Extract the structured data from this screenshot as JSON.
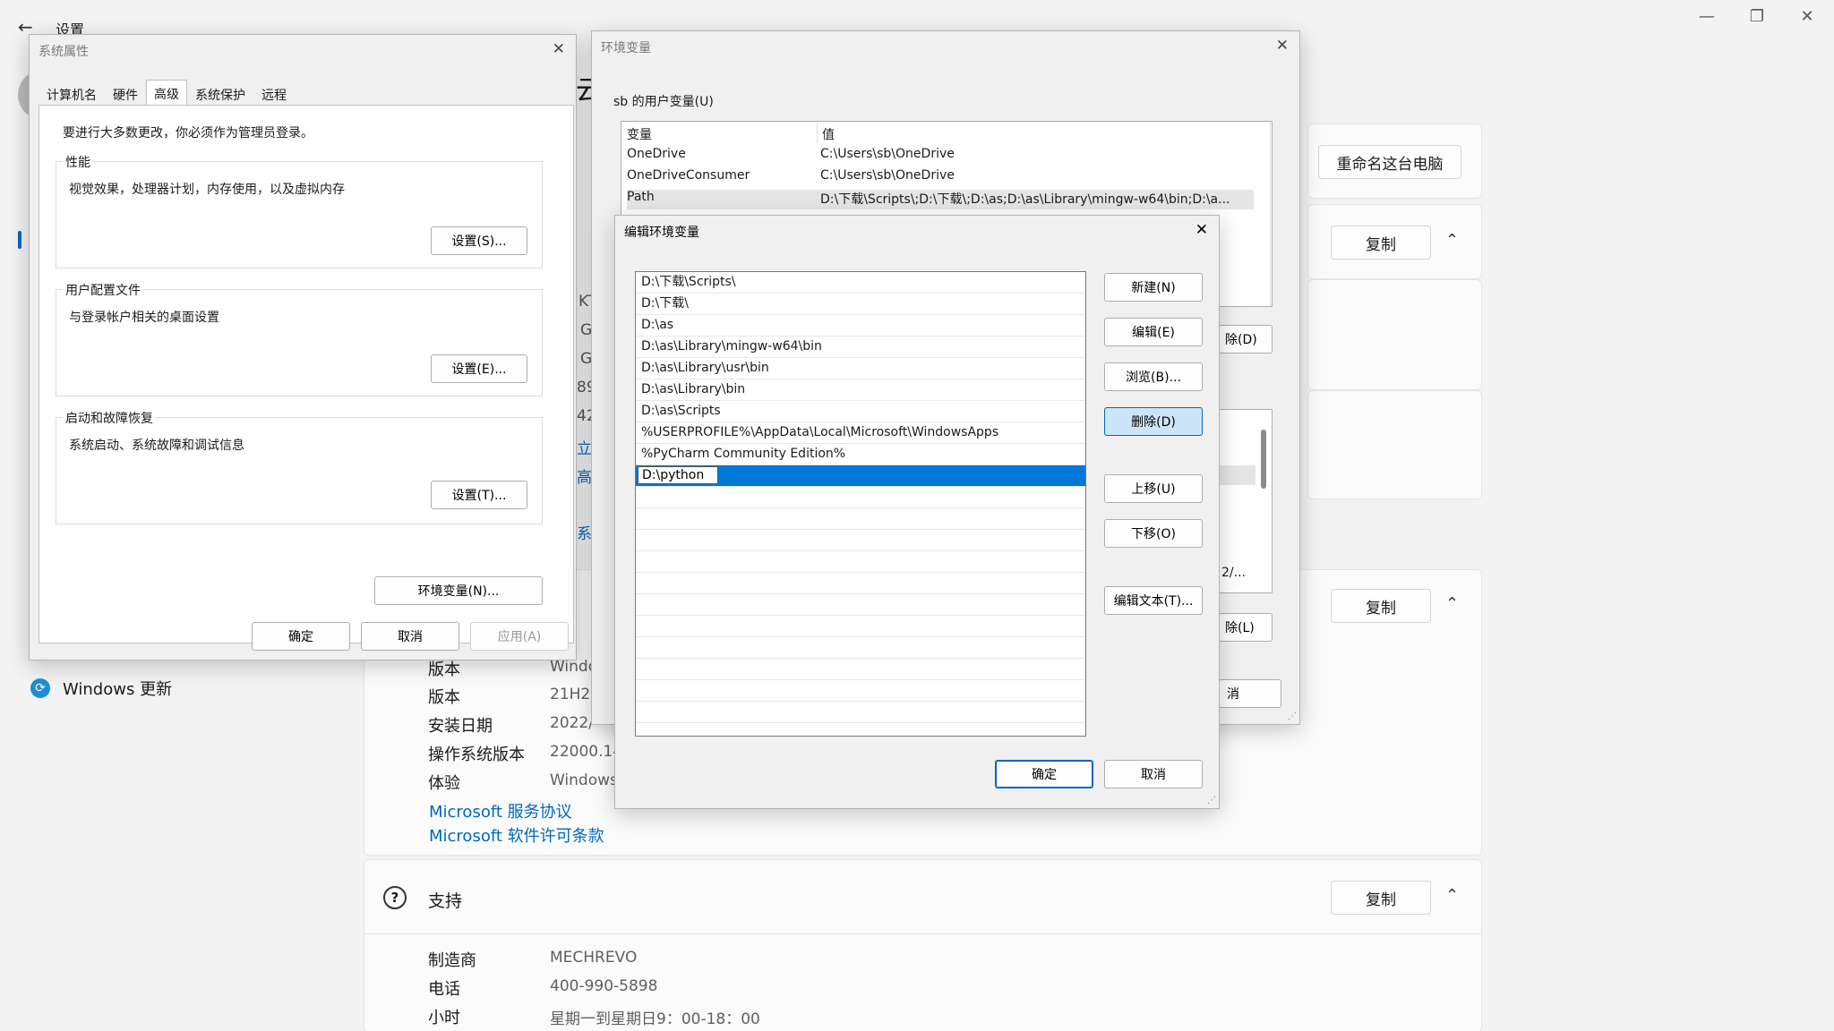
{
  "settings": {
    "title": "设置",
    "nav_windows_update": "Windows 更新",
    "rename_button": "重命名这台电脑",
    "copy_label": "复制",
    "windows_spec_rows": [
      {
        "label": "版本",
        "value": "Windo"
      },
      {
        "label": "版本",
        "value": "21H2"
      },
      {
        "label": "安装日期",
        "value": "2022/"
      },
      {
        "label": "操作系统版本",
        "value": "22000.14"
      },
      {
        "label": "体验",
        "value": "Windows"
      }
    ],
    "links": [
      "Microsoft 服务协议",
      "Microsoft 软件许可条款"
    ],
    "support": {
      "title": "支持",
      "rows": [
        {
          "label": "制造商",
          "value": "MECHREVO"
        },
        {
          "label": "电话",
          "value": "400-990-5898"
        },
        {
          "label": "小时",
          "value": "星期一到星期日9：00-18：00"
        }
      ]
    },
    "partial": {
      "heading_frag": "云",
      "k": "KT",
      "g1": "G",
      "g2": "G",
      "n89": "89",
      "n42": "42",
      "li": "立",
      "lin": "高",
      "xi": "系"
    }
  },
  "sysprops": {
    "title": "系统属性",
    "tabs": [
      "计算机名",
      "硬件",
      "高级",
      "系统保护",
      "远程"
    ],
    "admin_note": "要进行大多数更改，你必须作为管理员登录。",
    "groups": [
      {
        "label": "性能",
        "desc": "视觉效果，处理器计划，内存使用，以及虚拟内存",
        "button": "设置(S)..."
      },
      {
        "label": "用户配置文件",
        "desc": "与登录帐户相关的桌面设置",
        "button": "设置(E)..."
      },
      {
        "label": "启动和故障恢复",
        "desc": "系统启动、系统故障和调试信息",
        "button": "设置(T)..."
      }
    ],
    "env_button": "环境变量(N)...",
    "ok": "确定",
    "cancel": "取消",
    "apply": "应用(A)"
  },
  "envvars": {
    "title": "环境变量",
    "user_section": "sb 的用户变量(U)",
    "col_var": "变量",
    "col_val": "值",
    "rows": [
      {
        "name": "OneDrive",
        "value": "C:\\Users\\sb\\OneDrive"
      },
      {
        "name": "OneDriveConsumer",
        "value": "C:\\Users\\sb\\OneDrive"
      },
      {
        "name": "Path",
        "value": "D:\\下载\\Scripts\\;D:\\下载\\;D:\\as;D:\\as\\Library\\mingw-w64\\bin;D:\\a..."
      }
    ],
    "frag_delete_d": "除(D)",
    "frag_path": "2/...",
    "frag_delete_l": "除(L)",
    "frag_cancel": "消"
  },
  "editenv": {
    "title": "编辑环境变量",
    "entries": [
      "D:\\下载\\Scripts\\",
      "D:\\下载\\",
      "D:\\as",
      "D:\\as\\Library\\mingw-w64\\bin",
      "D:\\as\\Library\\usr\\bin",
      "D:\\as\\Library\\bin",
      "D:\\as\\Scripts",
      "%USERPROFILE%\\AppData\\Local\\Microsoft\\WindowsApps",
      "%PyCharm Community Edition%"
    ],
    "editing_value": "D:\\python",
    "buttons": {
      "new": "新建(N)",
      "edit": "编辑(E)",
      "browse": "浏览(B)...",
      "delete": "删除(D)",
      "up": "上移(U)",
      "down": "下移(O)",
      "edit_text": "编辑文本(T)..."
    },
    "ok": "确定",
    "cancel": "取消"
  }
}
